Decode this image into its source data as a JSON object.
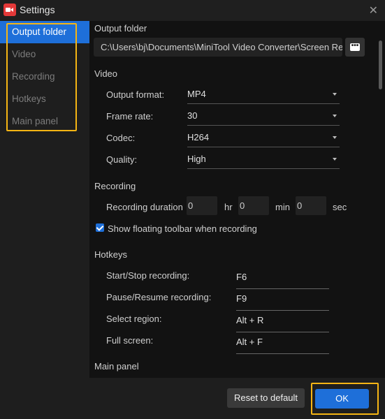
{
  "window": {
    "title": "Settings",
    "app_icon": "video-camera-icon",
    "close_icon": "close-icon",
    "close_glyph": "✕"
  },
  "sidebar": {
    "items": [
      {
        "label": "Output folder",
        "active": true
      },
      {
        "label": "Video",
        "active": false
      },
      {
        "label": "Recording",
        "active": false
      },
      {
        "label": "Hotkeys",
        "active": false
      },
      {
        "label": "Main panel",
        "active": false
      }
    ]
  },
  "output_folder": {
    "title": "Output folder",
    "path": "C:\\Users\\bj\\Documents\\MiniTool Video Converter\\Screen Rec",
    "browse_icon": "more-icon",
    "browse_glyph": "•••"
  },
  "video": {
    "title": "Video",
    "fields": [
      {
        "label": "Output format:",
        "value": "MP4"
      },
      {
        "label": "Frame rate:",
        "value": "30"
      },
      {
        "label": "Codec:",
        "value": "H264"
      },
      {
        "label": "Quality:",
        "value": "High"
      }
    ]
  },
  "recording": {
    "title": "Recording",
    "duration_label": "Recording duration",
    "hr_value": "0",
    "hr_unit": "hr",
    "min_value": "0",
    "min_unit": "min",
    "sec_value": "0",
    "sec_unit": "sec",
    "floating_toolbar_label": "Show floating toolbar when recording",
    "floating_toolbar_checked": true
  },
  "hotkeys": {
    "title": "Hotkeys",
    "items": [
      {
        "label": "Start/Stop recording:",
        "value": "F6"
      },
      {
        "label": "Pause/Resume recording:",
        "value": "F9"
      },
      {
        "label": "Select region:",
        "value": "Alt + R"
      },
      {
        "label": "Full screen:",
        "value": "Alt + F"
      }
    ]
  },
  "main_panel": {
    "title": "Main panel"
  },
  "footer": {
    "reset_label": "Reset to default",
    "ok_label": "OK"
  },
  "colors": {
    "accent": "#1e6fd9",
    "highlight": "#f5b514",
    "app_icon": "#e33838"
  }
}
